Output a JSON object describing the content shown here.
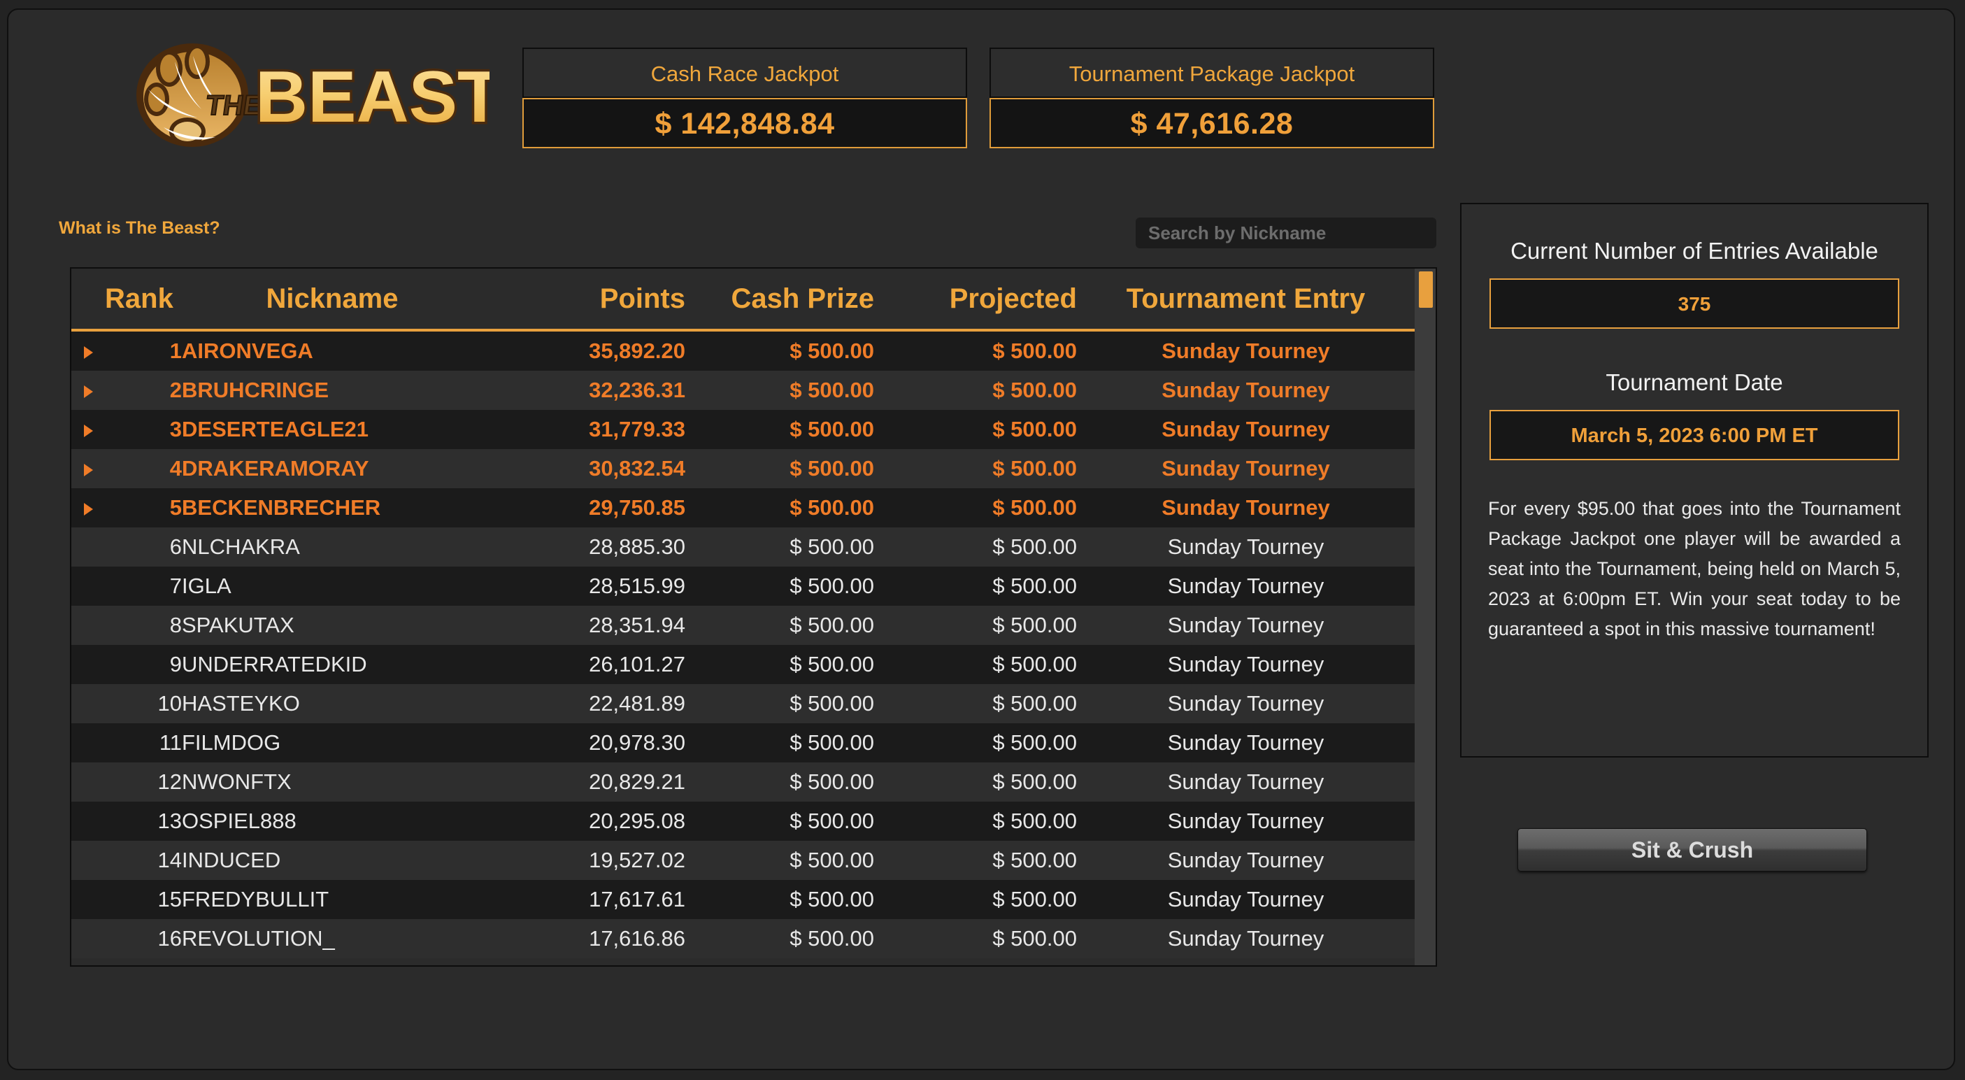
{
  "brand": {
    "logo_text": "THE BEAST",
    "logo_word_the": "THE",
    "logo_word_beast": "BEAST"
  },
  "colors": {
    "accent_orange": "#e8a03e",
    "highlight_orange": "#f07c28",
    "page_background": "#2b2b2b",
    "row_dark": "#1b1b1b",
    "row_light": "#2e2e2e",
    "text_light": "#e8e8e8"
  },
  "header": {
    "jackpots": [
      {
        "label": "Cash Race Jackpot",
        "value": "$ 142,848.84"
      },
      {
        "label": "Tournament Package Jackpot",
        "value": "$ 47,616.28"
      }
    ]
  },
  "toolbar": {
    "what_is_link": "What is The Beast?",
    "search_placeholder": "Search by Nickname",
    "search_value": ""
  },
  "leaderboard": {
    "columns": [
      "Rank",
      "Nickname",
      "Points",
      "Cash Prize",
      "Projected",
      "Tournament Entry"
    ],
    "rows": [
      {
        "rank": "1",
        "nickname": "AIRONVEGA",
        "points": "35,892.20",
        "cash_prize": "$ 500.00",
        "projected": "$ 500.00",
        "entry": "Sunday Tourney",
        "highlighted": true
      },
      {
        "rank": "2",
        "nickname": "BRUHCRINGE",
        "points": "32,236.31",
        "cash_prize": "$ 500.00",
        "projected": "$ 500.00",
        "entry": "Sunday Tourney",
        "highlighted": true
      },
      {
        "rank": "3",
        "nickname": "DESERTEAGLE21",
        "points": "31,779.33",
        "cash_prize": "$ 500.00",
        "projected": "$ 500.00",
        "entry": "Sunday Tourney",
        "highlighted": true
      },
      {
        "rank": "4",
        "nickname": "DRAKERAMORAY",
        "points": "30,832.54",
        "cash_prize": "$ 500.00",
        "projected": "$ 500.00",
        "entry": "Sunday Tourney",
        "highlighted": true
      },
      {
        "rank": "5",
        "nickname": "BECKENBRECHER",
        "points": "29,750.85",
        "cash_prize": "$ 500.00",
        "projected": "$ 500.00",
        "entry": "Sunday Tourney",
        "highlighted": true
      },
      {
        "rank": "6",
        "nickname": "NLCHAKRA",
        "points": "28,885.30",
        "cash_prize": "$ 500.00",
        "projected": "$ 500.00",
        "entry": "Sunday Tourney",
        "highlighted": false
      },
      {
        "rank": "7",
        "nickname": "IGLA",
        "points": "28,515.99",
        "cash_prize": "$ 500.00",
        "projected": "$ 500.00",
        "entry": "Sunday Tourney",
        "highlighted": false
      },
      {
        "rank": "8",
        "nickname": "SPAKUTAX",
        "points": "28,351.94",
        "cash_prize": "$ 500.00",
        "projected": "$ 500.00",
        "entry": "Sunday Tourney",
        "highlighted": false
      },
      {
        "rank": "9",
        "nickname": "UNDERRATEDKID",
        "points": "26,101.27",
        "cash_prize": "$ 500.00",
        "projected": "$ 500.00",
        "entry": "Sunday Tourney",
        "highlighted": false
      },
      {
        "rank": "10",
        "nickname": "HASTEYKO",
        "points": "22,481.89",
        "cash_prize": "$ 500.00",
        "projected": "$ 500.00",
        "entry": "Sunday Tourney",
        "highlighted": false
      },
      {
        "rank": "11",
        "nickname": "FILMDOG",
        "points": "20,978.30",
        "cash_prize": "$ 500.00",
        "projected": "$ 500.00",
        "entry": "Sunday Tourney",
        "highlighted": false
      },
      {
        "rank": "12",
        "nickname": "NWONFTX",
        "points": "20,829.21",
        "cash_prize": "$ 500.00",
        "projected": "$ 500.00",
        "entry": "Sunday Tourney",
        "highlighted": false
      },
      {
        "rank": "13",
        "nickname": "OSPIEL888",
        "points": "20,295.08",
        "cash_prize": "$ 500.00",
        "projected": "$ 500.00",
        "entry": "Sunday Tourney",
        "highlighted": false
      },
      {
        "rank": "14",
        "nickname": "INDUCED",
        "points": "19,527.02",
        "cash_prize": "$ 500.00",
        "projected": "$ 500.00",
        "entry": "Sunday Tourney",
        "highlighted": false
      },
      {
        "rank": "15",
        "nickname": "FREDYBULLIT",
        "points": "17,617.61",
        "cash_prize": "$ 500.00",
        "projected": "$ 500.00",
        "entry": "Sunday Tourney",
        "highlighted": false
      },
      {
        "rank": "16",
        "nickname": "REVOLUTION_",
        "points": "17,616.86",
        "cash_prize": "$ 500.00",
        "projected": "$ 500.00",
        "entry": "Sunday Tourney",
        "highlighted": false
      }
    ]
  },
  "side_panel": {
    "entries_heading": "Current Number of Entries Available",
    "entries_value": "375",
    "date_heading": "Tournament Date",
    "date_value": "March 5, 2023 6:00 PM ET",
    "description": "For every $95.00 that goes into the Tournament Package Jackpot one player will be awarded a seat into the Tournament, being held on March 5, 2023 at 6:00pm ET. Win your seat today to be guaranteed a spot in this massive tournament!"
  },
  "actions": {
    "sit_and_crush_label": "Sit & Crush"
  }
}
